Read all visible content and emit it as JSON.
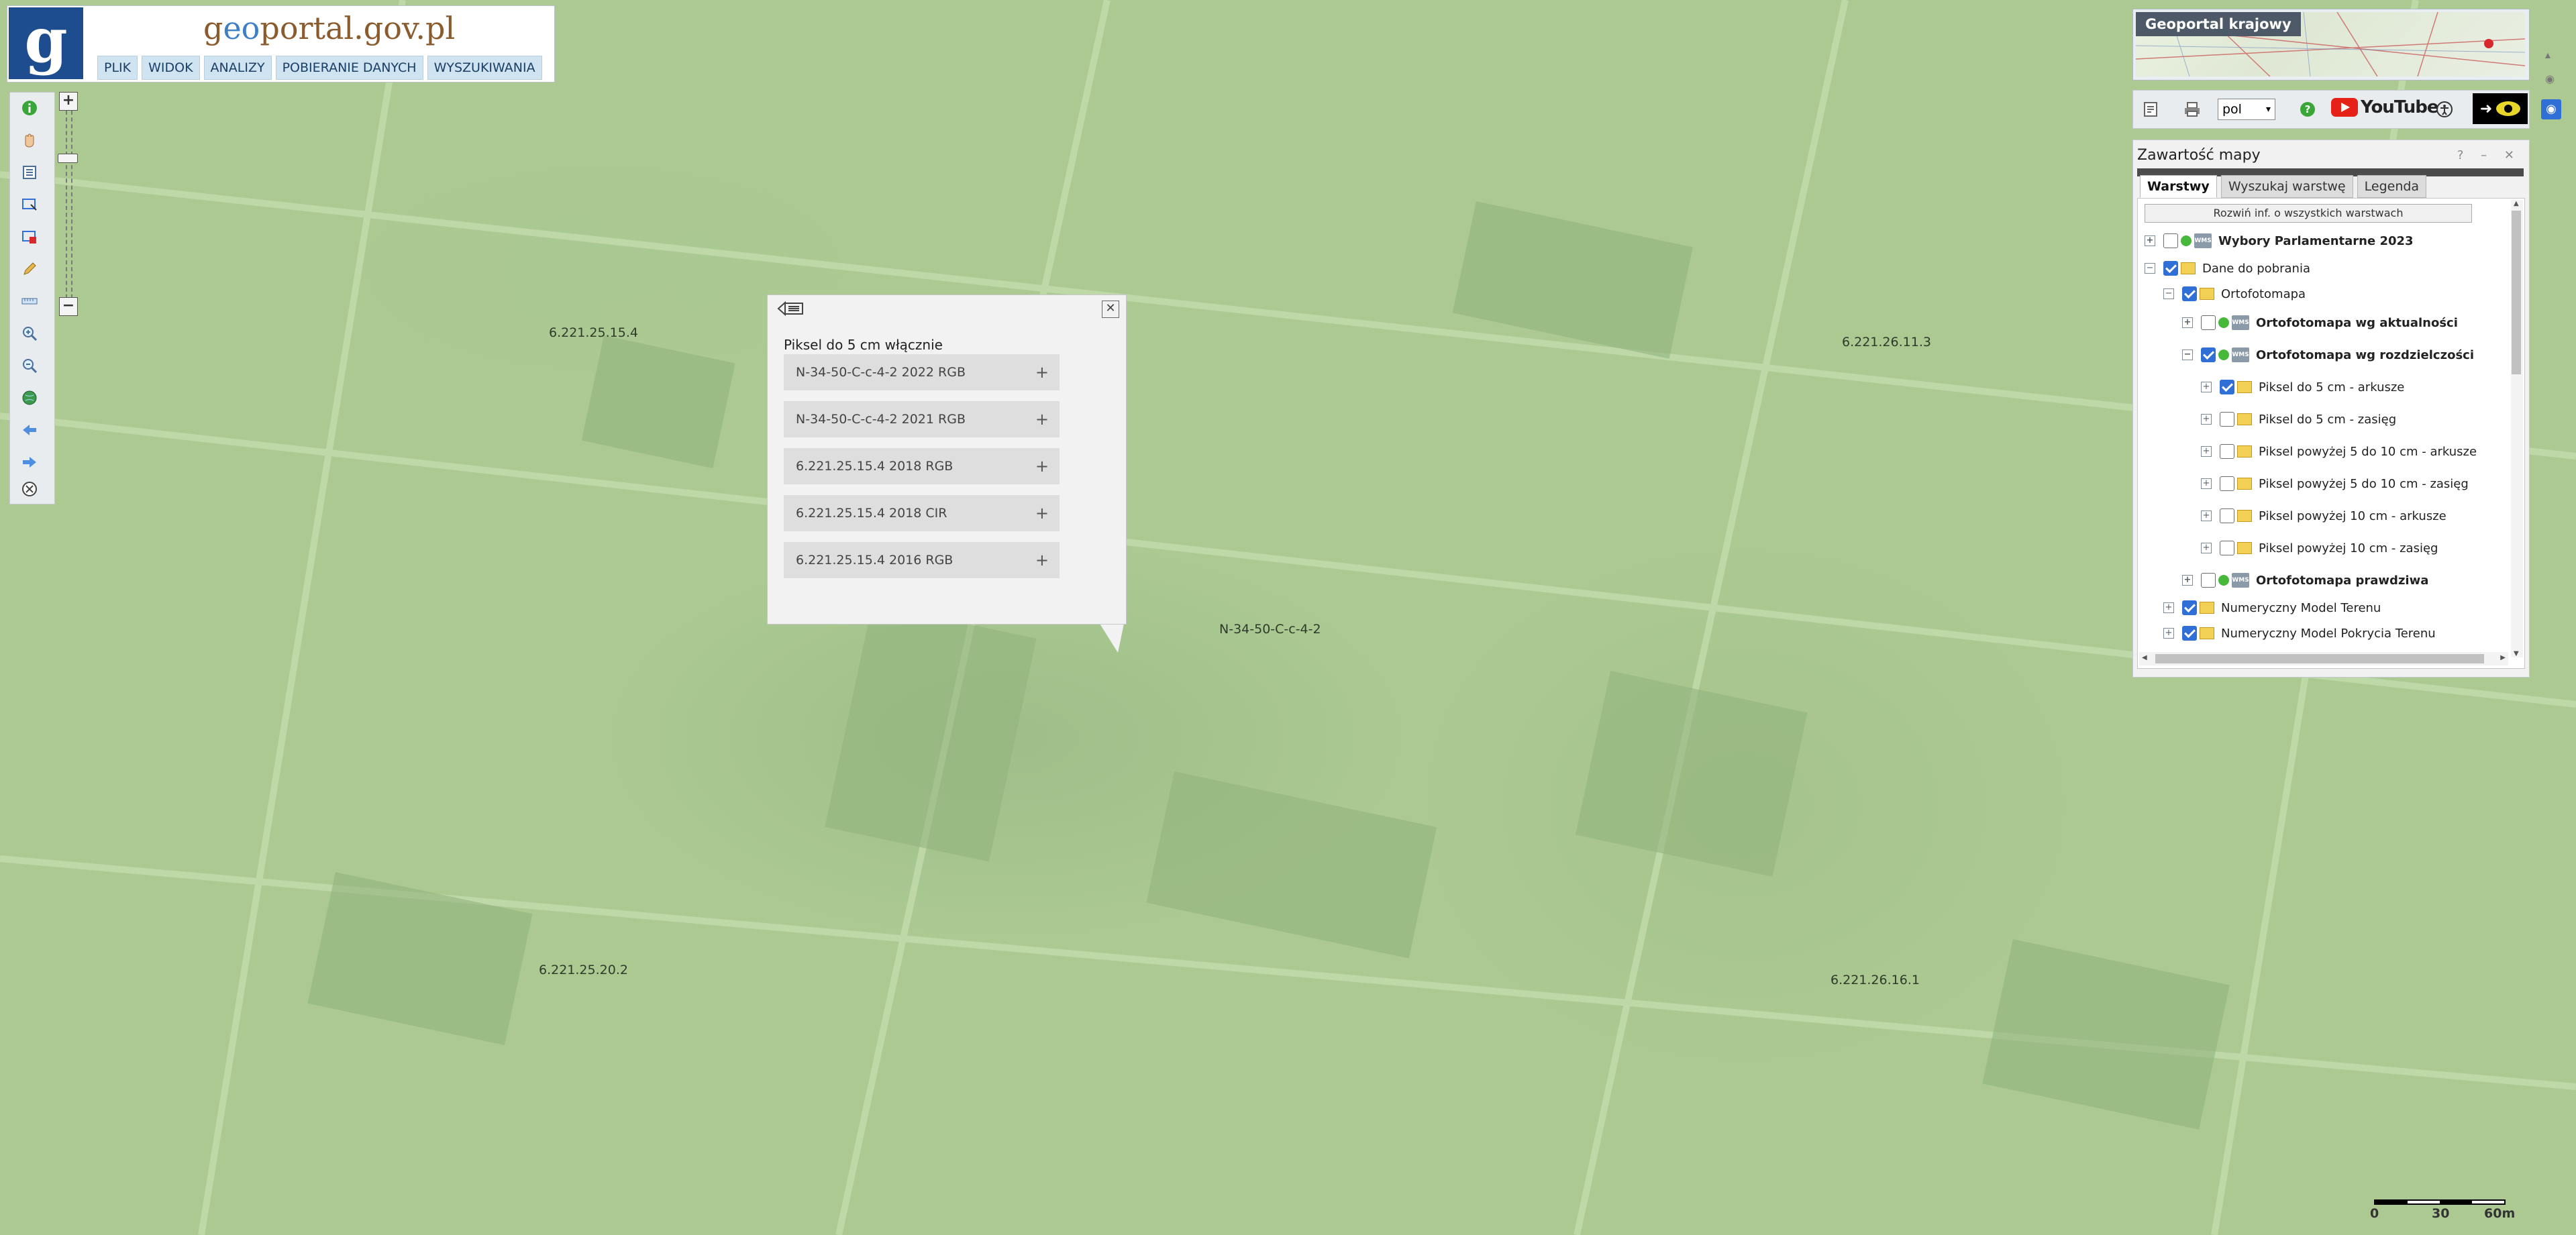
{
  "header": {
    "logo_letter": "g",
    "title_part1": "g",
    "title_part2": "eo",
    "title_part3": "portal.gov.pl",
    "menu": [
      "PLIK",
      "WIDOK",
      "ANALIZY",
      "POBIERANIE DANYCH",
      "WYSZUKIWANIA"
    ]
  },
  "map": {
    "labels": [
      "6.221.25.15.4",
      "6.221.26.11.3",
      "N-34-50-C-c-4-2",
      "6.221.25.20.2",
      "6.221.26.16.1"
    ]
  },
  "popup": {
    "heading": "Piksel do 5 cm włącznie",
    "rows": [
      "N-34-50-C-c-4-2 2022 RGB",
      "N-34-50-C-c-4-2 2021 RGB",
      "6.221.25.15.4 2018 RGB",
      "6.221.25.15.4 2018 CIR",
      "6.221.25.15.4 2016 RGB"
    ],
    "plus": "+"
  },
  "overview": {
    "title": "Geoportal krajowy"
  },
  "tools": {
    "language": "pol",
    "youtube": "YouTube"
  },
  "layers": {
    "title": "Zawartość mapy",
    "controls": "? – ✕",
    "tabs": [
      "Warstwy",
      "Wyszukaj warstwę",
      "Legenda"
    ],
    "expand_all": "Rozwiń inf. o wszystkich warstwach",
    "tree": [
      "Wybory Parlamentarne 2023",
      "Dane do pobrania",
      "Ortofotomapa",
      "Ortofotomapa wg aktualności",
      "Ortofotomapa wg rozdzielczości",
      "Piksel do 5 cm - arkusze",
      "Piksel do 5 cm - zasięg",
      "Piksel powyżej 5 do 10 cm - arkusze",
      "Piksel powyżej 5 do 10 cm - zasięg",
      "Piksel powyżej 10 cm - arkusze",
      "Piksel powyżej 10 cm - zasięg",
      "Ortofotomapa prawdziwa",
      "Numeryczny Model Terenu",
      "Numeryczny Model Pokrycia Terenu"
    ]
  },
  "scale": {
    "labels": [
      "0",
      "30",
      "60m"
    ]
  }
}
